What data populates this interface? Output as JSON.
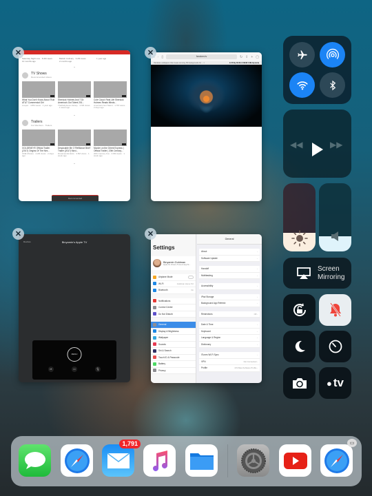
{
  "app_switcher": {
    "cards": {
      "youtube": {
        "top_row": [
          {
            "meta1": "Saturday Night Live · 8.4M views",
            "meta2": "10 months ago"
          },
          {
            "meta1": "Babish Culinary · 3.2M views",
            "meta2": "2 months ago"
          },
          {
            "meta1": "1 year ago",
            "meta2": ""
          }
        ],
        "sections": [
          {
            "title": "TV Shows",
            "subtitle": "Recommended videos",
            "videos": [
              {
                "title": "What You Don't Know About That AT&T Commercial Girl",
                "meta": "Looper · 4.8M views · 1 year ago"
              },
              {
                "title": "Sherlock Holmes And 7 Dr. America's Got Talent 201...",
                "meta": "TheDailyGoss Variety · 3.6M views · 1 week ago"
              },
              {
                "title": "Cole Cloud: Real Life Sherlock Holmes Reads Minds...",
                "meta": "America's Got Talent · 1.7M views · 2 days ago"
              }
            ]
          },
          {
            "title": "Trailers",
            "subtitle": "For Members · Trailers",
            "videos": [
              {
                "title": "GOLDENEYE Official Trailer (2017) Origins Of The Nex...",
                "meta": "ONE Movies · 4.2M views · 2 days ago"
              },
              {
                "title": "Despicable Me 3 'Refillance Brief' Trailer (2017) Movi...",
                "meta": "Dreamworks Ents · 3.5M views · 1 week ago"
              },
              {
                "title": "Murder on the Orient Express | Official Trailer | 20th Century...",
                "meta": "20th Century Fox · 4.8M views · 1 week ago"
              }
            ]
          }
        ],
        "bottom_bar": "Recommended"
      },
      "safari": {
        "url": "fandom.tv",
        "tab_left": "Hardware wallpapers that create stunning HD backgrounds for ... ×",
        "tab_right": "E Z6 Ny X9 Shi 3 NEW 4 Mk Hysteria"
      },
      "tv_remote": {
        "title": "Binyamin's Apple TV",
        "back_label": "Devices",
        "menu_label": "MENU",
        "buttons": [
          "play-pause",
          "tv",
          "mic"
        ]
      },
      "settings": {
        "title": "Settings",
        "profile": {
          "name": "Binyamin Goldman",
          "sub": "Apple ID, iCloud, iTunes & App St..."
        },
        "groups": [
          [
            {
              "label": "Airplane Mode",
              "value": "",
              "color": "#f5a623",
              "toggle": true
            },
            {
              "label": "Wi-Fi",
              "value": "Goldman Home 5.0",
              "color": "#1e88e5"
            },
            {
              "label": "Bluetooth",
              "value": "On",
              "color": "#1e88e5"
            }
          ],
          [
            {
              "label": "Notifications",
              "value": "",
              "color": "#e53935"
            },
            {
              "label": "Control Center",
              "value": "",
              "color": "#8e8e93"
            },
            {
              "label": "Do Not Disturb",
              "value": "",
              "color": "#5c4fc9"
            }
          ],
          [
            {
              "label": "General",
              "value": "",
              "color": "#8e8e93",
              "active": true
            },
            {
              "label": "Display & Brightness",
              "value": "",
              "color": "#1e88e5"
            },
            {
              "label": "Wallpaper",
              "value": "",
              "color": "#33a7e0"
            },
            {
              "label": "Sounds",
              "value": "",
              "color": "#e53950"
            },
            {
              "label": "Siri & Search",
              "value": "",
              "color": "#333366"
            },
            {
              "label": "Touch ID & Passcode",
              "value": "",
              "color": "#e54f50"
            },
            {
              "label": "Battery",
              "value": "",
              "color": "#4cd964"
            },
            {
              "label": "Privacy",
              "value": "",
              "color": "#8e8e93"
            }
          ]
        ],
        "detail": {
          "header": "General",
          "groups": [
            [
              {
                "label": "About",
                "value": ""
              },
              {
                "label": "Software Update",
                "value": ""
              }
            ],
            [
              {
                "label": "Handoff",
                "value": ""
              },
              {
                "label": "Multitasking",
                "value": ""
              }
            ],
            [
              {
                "label": "Accessibility",
                "value": ""
              }
            ],
            [
              {
                "label": "iPad Storage",
                "value": ""
              },
              {
                "label": "Background App Refresh",
                "value": ""
              }
            ],
            [
              {
                "label": "Restrictions",
                "value": "Off"
              }
            ],
            [
              {
                "label": "Date & Time",
                "value": ""
              },
              {
                "label": "Keyboard",
                "value": ""
              },
              {
                "label": "Language & Region",
                "value": ""
              },
              {
                "label": "Dictionary",
                "value": ""
              }
            ],
            [
              {
                "label": "iTunes Wi-Fi Sync",
                "value": ""
              },
              {
                "label": "VPN",
                "value": "Not Connected"
              },
              {
                "label": "Profile",
                "value": "iOS Beta Software Profile"
              }
            ]
          ]
        }
      }
    }
  },
  "control_center": {
    "connectivity": {
      "airplane_mode": {
        "state": "off",
        "icon": "airplane-icon"
      },
      "airdrop": {
        "state": "on",
        "icon": "airdrop-icon"
      },
      "wifi": {
        "state": "on",
        "icon": "wifi-icon"
      },
      "bluetooth": {
        "state": "off",
        "icon": "bluetooth-icon"
      }
    },
    "media": {
      "rewind": "◀◀",
      "play": "play",
      "forward": "▶▶"
    },
    "brightness_level": 0.27,
    "volume_level": 0.22,
    "screen_mirroring": {
      "line1": "Screen",
      "line2": "Mirroring"
    },
    "tiles": [
      "orientation-lock",
      "mute",
      "do-not-disturb",
      "timer",
      "camera",
      "apple-tv-remote"
    ],
    "apple_tv_label": "tv",
    "accent_color": "#1b84f5",
    "mute_color": "#f0443a"
  },
  "dock": {
    "apps": [
      {
        "name": "Messages"
      },
      {
        "name": "Safari"
      },
      {
        "name": "Mail",
        "badge": "1,791"
      },
      {
        "name": "Music"
      },
      {
        "name": "Files"
      },
      {
        "name": "Settings"
      },
      {
        "name": "YouTube"
      },
      {
        "name": "Safari"
      }
    ]
  }
}
